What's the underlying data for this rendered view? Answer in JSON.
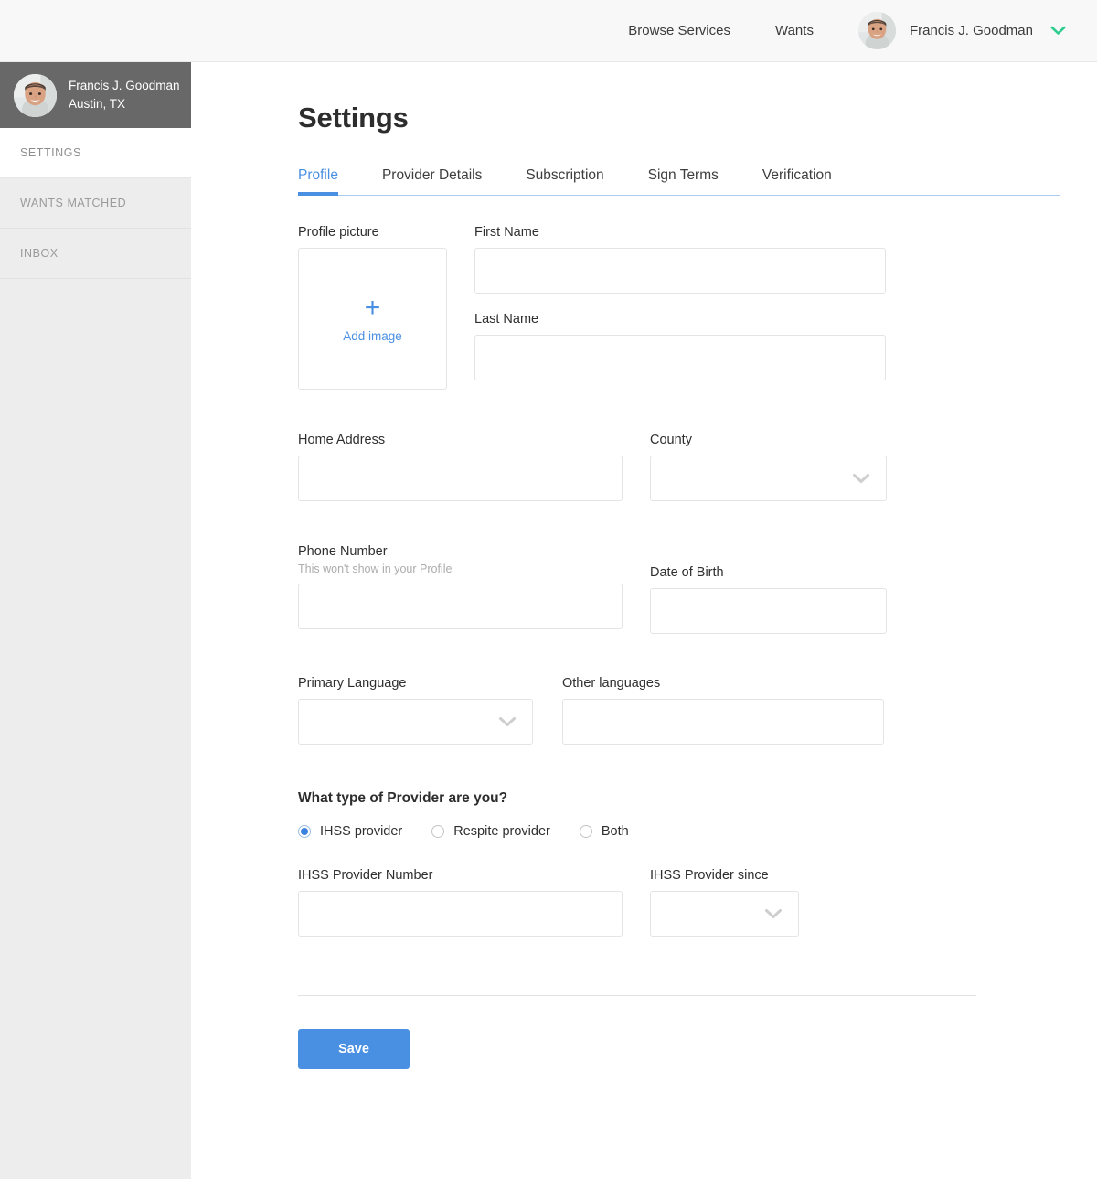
{
  "header": {
    "nav_links": [
      {
        "label": "Browse Services"
      },
      {
        "label": "Wants"
      }
    ],
    "user_name": "Francis J. Goodman",
    "chevron_color": "#2ecc8f"
  },
  "sidebar": {
    "user_name": "Francis J. Goodman",
    "user_location": "Austin, TX",
    "items": [
      {
        "label": "SETTINGS",
        "active": true
      },
      {
        "label": "WANTS MATCHED",
        "active": false
      },
      {
        "label": "INBOX",
        "active": false
      }
    ]
  },
  "main": {
    "page_title": "Settings",
    "accent_color": "#4a90e2",
    "tabs": [
      {
        "label": "Profile",
        "active": true
      },
      {
        "label": "Provider Details",
        "active": false
      },
      {
        "label": "Subscription",
        "active": false
      },
      {
        "label": "Sign Terms",
        "active": false
      },
      {
        "label": "Verification",
        "active": false
      }
    ],
    "form": {
      "profile_picture": {
        "label": "Profile picture",
        "add_image_label": "Add image",
        "plus_glyph": "+"
      },
      "first_name": {
        "label": "First Name",
        "value": "",
        "placeholder": ""
      },
      "last_name": {
        "label": "Last Name",
        "value": "",
        "placeholder": ""
      },
      "home_address": {
        "label": "Home Address",
        "value": "",
        "placeholder": ""
      },
      "county": {
        "label": "County",
        "value": "",
        "placeholder": ""
      },
      "phone_number": {
        "label": "Phone Number",
        "hint": "This won't show in your Profile",
        "value": "",
        "placeholder": ""
      },
      "date_of_birth": {
        "label": "Date of Birth",
        "value": "",
        "placeholder": ""
      },
      "primary_language": {
        "label": "Primary Language",
        "value": "",
        "placeholder": ""
      },
      "other_languages": {
        "label": "Other languages",
        "value": "",
        "placeholder": ""
      },
      "provider_type": {
        "question": "What type of Provider are you?",
        "options": [
          {
            "label": "IHSS provider",
            "selected": true
          },
          {
            "label": "Respite provider",
            "selected": false
          },
          {
            "label": "Both",
            "selected": false
          }
        ]
      },
      "ihss_provider_number": {
        "label": "IHSS Provider Number",
        "value": "",
        "placeholder": ""
      },
      "ihss_provider_since": {
        "label": "IHSS Provider since",
        "value": "",
        "placeholder": ""
      },
      "save_label": "Save"
    }
  }
}
